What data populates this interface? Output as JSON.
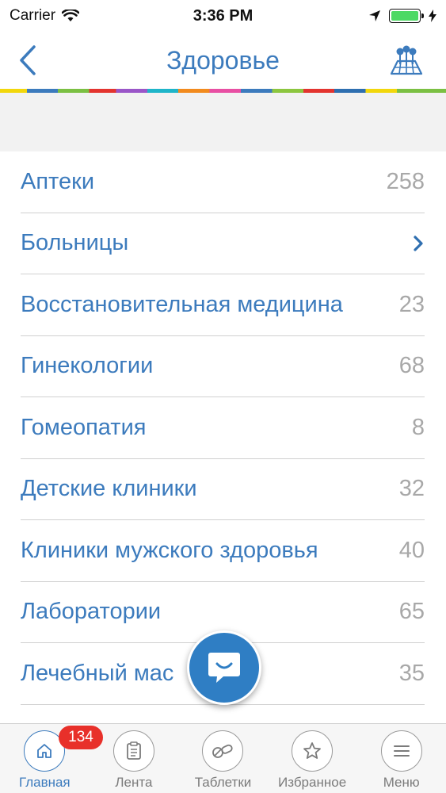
{
  "status_bar": {
    "carrier": "Carrier",
    "time": "3:36 PM"
  },
  "nav": {
    "title": "Здоровье"
  },
  "colors": {
    "accent": "#3c7bbd",
    "count": "#a8a8a8",
    "badge": "#e8302a",
    "fab": "#2f7ec4"
  },
  "list": {
    "items": [
      {
        "label": "Аптеки",
        "count": "258"
      },
      {
        "label": "Больницы",
        "count": ""
      },
      {
        "label": "Восстановительная медицина",
        "count": "23"
      },
      {
        "label": "Гинекологии",
        "count": "68"
      },
      {
        "label": "Гомеопатия",
        "count": "8"
      },
      {
        "label": "Детские клиники",
        "count": "32"
      },
      {
        "label": "Клиники мужского здоровья",
        "count": "40"
      },
      {
        "label": "Лаборатории",
        "count": "65"
      },
      {
        "label": "Лечебный мас",
        "count": "35"
      }
    ]
  },
  "tabs": [
    {
      "label": "Главная",
      "icon": "home-icon",
      "badge": "134"
    },
    {
      "label": "Лента",
      "icon": "clipboard-icon"
    },
    {
      "label": "Таблетки",
      "icon": "pills-icon"
    },
    {
      "label": "Избранное",
      "icon": "star-icon"
    },
    {
      "label": "Меню",
      "icon": "menu-icon"
    }
  ]
}
